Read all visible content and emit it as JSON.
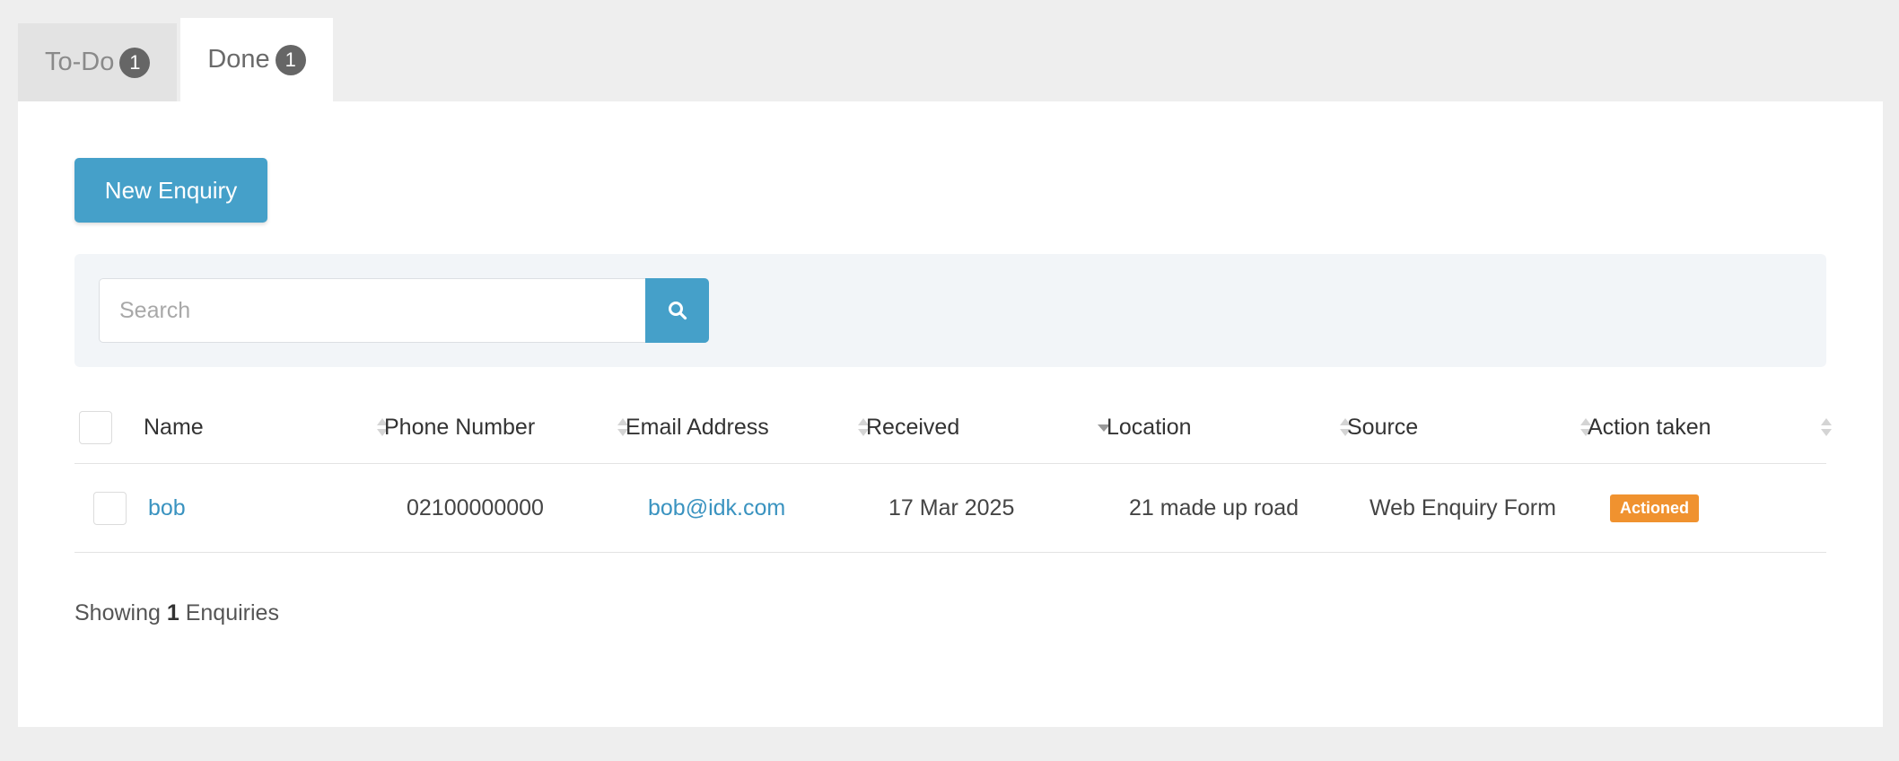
{
  "tabs": [
    {
      "label": "To-Do",
      "count": "1"
    },
    {
      "label": "Done",
      "count": "1"
    }
  ],
  "toolbar": {
    "new_label": "New Enquiry"
  },
  "search": {
    "placeholder": "Search",
    "value": "",
    "icon": "search-icon"
  },
  "table": {
    "columns": [
      "Name",
      "Phone Number",
      "Email Address",
      "Received",
      "Location",
      "Source",
      "Action taken"
    ],
    "sorted_column": "Received",
    "rows": [
      {
        "name": "bob",
        "phone": "02100000000",
        "email": "bob@idk.com",
        "received": "17 Mar 2025",
        "location": "21 made up road",
        "source": "Web Enquiry Form",
        "action": "Actioned"
      }
    ]
  },
  "footer": {
    "prefix": "Showing",
    "count": "1",
    "suffix": "Enquiries"
  },
  "colors": {
    "accent": "#45a0c9",
    "badge": "#f0922f",
    "link": "#3a93c0"
  }
}
